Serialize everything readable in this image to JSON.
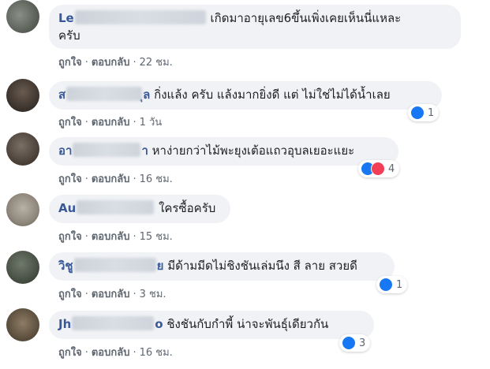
{
  "comments": [
    {
      "author_visible_start": "Le",
      "author_visible_end": "",
      "text": "เกิดมาอายุเลข6ขึ้นเพิ่งเคยเห็นนี่แหละ",
      "text_line2": "ครับ",
      "like_label": "ถูกใจ",
      "reply_label": "ตอบกลับ",
      "time": "22 ชม.",
      "reaction_count": ""
    },
    {
      "author_visible_start": "ส",
      "author_visible_end": "ุล",
      "text": "กิ่งแล้ง ครับ แล้งมากยิ่งดี แต่ ไม่ใช่ไม่ได้น้ำเลย",
      "like_label": "ถูกใจ",
      "reply_label": "ตอบกลับ",
      "time": "1 วัน",
      "reaction_count": "1"
    },
    {
      "author_visible_start": "อา",
      "author_visible_end": "า",
      "text": "หาง่ายกว่าไม้พะยุงเต้อแถวอุบลเยอะแยะ",
      "like_label": "ถูกใจ",
      "reply_label": "ตอบกลับ",
      "time": "16 ชม.",
      "reaction_count": "4"
    },
    {
      "author_visible_start": "Au",
      "author_visible_end": "",
      "text": "ใครซื้อครับ",
      "like_label": "ถูกใจ",
      "reply_label": "ตอบกลับ",
      "time": "15 ชม.",
      "reaction_count": ""
    },
    {
      "author_visible_start": "วิชู",
      "author_visible_end": "ย",
      "text": "มีด้ามมีดไม่ชิงชันเล่มนึง สี ลาย สวยดี",
      "like_label": "ถูกใจ",
      "reply_label": "ตอบกลับ",
      "time": "3 ชม.",
      "reaction_count": "1"
    },
    {
      "author_visible_start": "Jh",
      "author_visible_end": "o",
      "text": "ชิงชันกับกำพี้ น่าจะพันธุ์เดียวกัน",
      "like_label": "ถูกใจ",
      "reply_label": "ตอบกลับ",
      "time": "16 ชม.",
      "reaction_count": "3"
    }
  ],
  "colors": {
    "bubble_bg": "#f0f2f5",
    "author": "#385898",
    "meta": "#606770",
    "like": "#1877f2",
    "love": "#f33e58"
  },
  "icons": [
    "like-reaction-icon",
    "love-reaction-icon"
  ]
}
